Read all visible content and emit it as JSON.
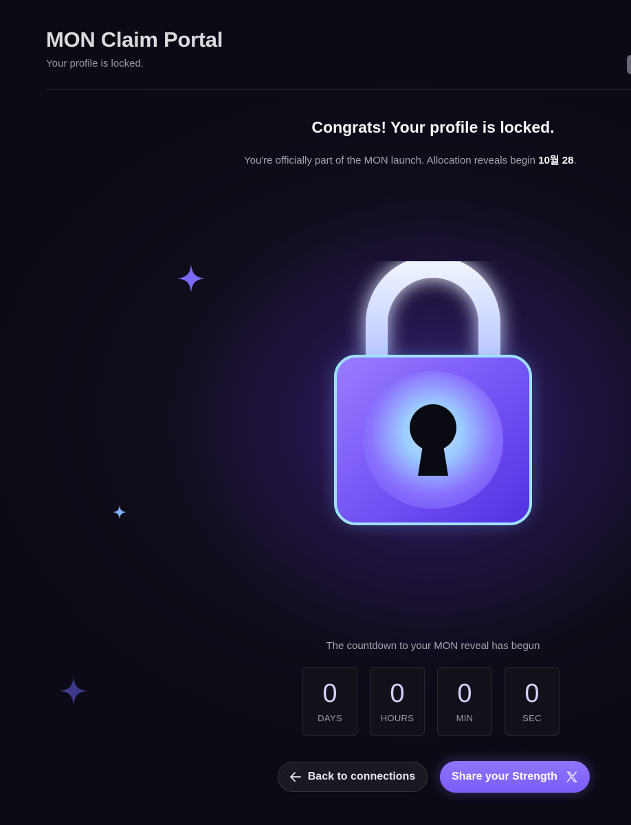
{
  "header": {
    "title": "MON Claim Portal",
    "subtitle": "Your profile is locked."
  },
  "main": {
    "headline": "Congrats! Your profile is locked.",
    "reveal_text": "You're officially part of the MON launch. Allocation reveals begin ",
    "reveal_date": "10월 28",
    "reveal_end": "."
  },
  "lock": {
    "icon": "padlock-icon",
    "colors": {
      "shackle": "#dfe8ff",
      "body_top": "#8a6cff",
      "body_bottom": "#5a35e6",
      "glow": "#7fd0ff"
    }
  },
  "countdown": {
    "caption": "The countdown to your MON reveal has begun",
    "units": [
      {
        "value": "0",
        "label": "DAYS"
      },
      {
        "value": "0",
        "label": "HOURS"
      },
      {
        "value": "0",
        "label": "MIN"
      },
      {
        "value": "0",
        "label": "SEC"
      }
    ]
  },
  "actions": {
    "back_label": "Back to connections",
    "back_icon": "arrow-left-icon",
    "share_label": "Share your Strength",
    "share_icon": "x-logo-icon"
  },
  "theme": {
    "accent": "#7b5cf6",
    "background": "#0b0912"
  }
}
